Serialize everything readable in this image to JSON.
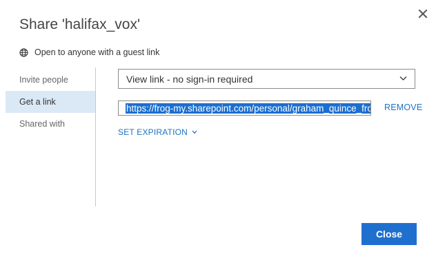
{
  "dialog": {
    "title": "Share 'halifax_vox'",
    "subtitle": "Open to anyone with a guest link",
    "close_icon": "close-icon",
    "globe_icon": "globe-icon"
  },
  "nav": {
    "items": [
      {
        "label": "Invite people",
        "active": false
      },
      {
        "label": "Get a link",
        "active": true
      },
      {
        "label": "Shared with",
        "active": false
      }
    ]
  },
  "link": {
    "type_selected": "View link - no sign-in required",
    "url": "https://frog-my.sharepoint.com/personal/graham_quince_frogeducation_com",
    "remove_label": "REMOVE",
    "expiration_label": "SET EXPIRATION"
  },
  "footer": {
    "close_label": "Close"
  },
  "colors": {
    "accent": "#1a73c4",
    "button": "#1f6fcf",
    "nav_active_bg": "#dbe9f7",
    "selection": "#1a6fd1"
  }
}
